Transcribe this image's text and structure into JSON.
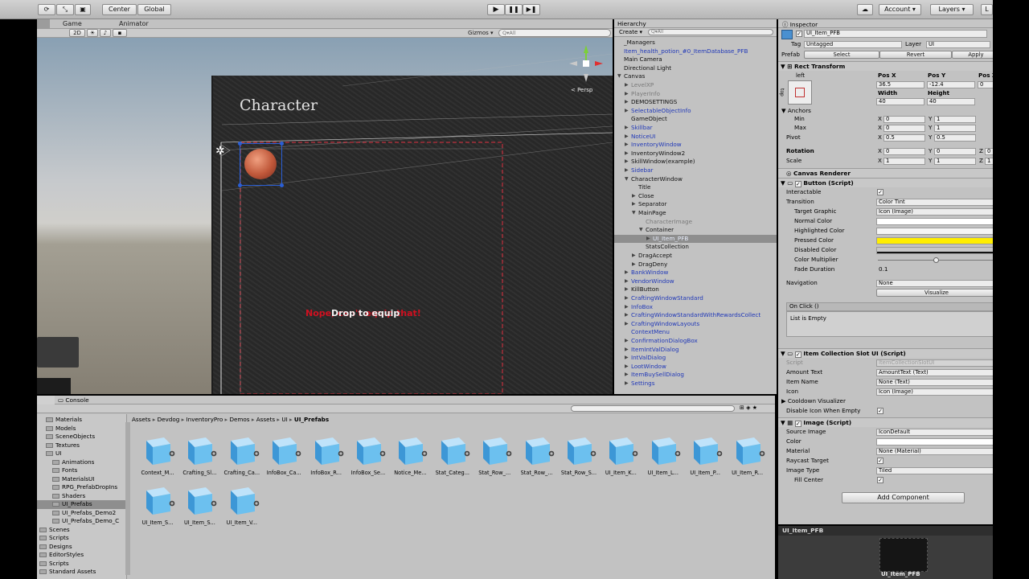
{
  "toolbar": {
    "center": "Center",
    "global": "Global",
    "account": "Account ▾",
    "layers": "Layers ▾",
    "layout": "L"
  },
  "scene": {
    "tabs": {
      "game": "Game",
      "animator": "Animator"
    },
    "mode_2d": "2D",
    "gizmos": "Gizmos ▾",
    "search": "Q▾All",
    "persp": "< Persp",
    "panel_title": "Character",
    "overlay_red": "Nope, can't equip that!",
    "overlay_white": "Drop to equip"
  },
  "hierarchy": {
    "title": "Hierarchy",
    "create": "Create ▾",
    "search": "Q▾All",
    "items": [
      {
        "label": "_Managers",
        "cls": "dark",
        "indent": 0,
        "arrow": ""
      },
      {
        "label": "Item_health_potion_#0_ItemDatabase_PFB",
        "cls": "blue",
        "indent": 0,
        "arrow": ""
      },
      {
        "label": "Main Camera",
        "cls": "dark",
        "indent": 0,
        "arrow": ""
      },
      {
        "label": "Directional Light",
        "cls": "dark",
        "indent": 0,
        "arrow": ""
      },
      {
        "label": "Canvas",
        "cls": "dark",
        "indent": 0,
        "arrow": "▼"
      },
      {
        "label": "LevelXP",
        "cls": "gray",
        "indent": 1,
        "arrow": "▶"
      },
      {
        "label": "PlayerInfo",
        "cls": "gray",
        "indent": 1,
        "arrow": "▶"
      },
      {
        "label": "DEMOSETTINGS",
        "cls": "dark",
        "indent": 1,
        "arrow": "▶"
      },
      {
        "label": "SelectableObjectInfo",
        "cls": "blue",
        "indent": 1,
        "arrow": "▶"
      },
      {
        "label": "GameObject",
        "cls": "dark",
        "indent": 1,
        "arrow": ""
      },
      {
        "label": "Skillbar",
        "cls": "blue",
        "indent": 1,
        "arrow": "▶"
      },
      {
        "label": "NoticeUI",
        "cls": "blue",
        "indent": 1,
        "arrow": "▶"
      },
      {
        "label": "InventoryWindow",
        "cls": "blue",
        "indent": 1,
        "arrow": "▶"
      },
      {
        "label": "InventoryWindow2",
        "cls": "dark",
        "indent": 1,
        "arrow": "▶"
      },
      {
        "label": "SkillWindow(example)",
        "cls": "dark",
        "indent": 1,
        "arrow": "▶"
      },
      {
        "label": "Sidebar",
        "cls": "blue",
        "indent": 1,
        "arrow": "▶"
      },
      {
        "label": "CharacterWindow",
        "cls": "dark",
        "indent": 1,
        "arrow": "▼"
      },
      {
        "label": "Title",
        "cls": "dark",
        "indent": 2,
        "arrow": ""
      },
      {
        "label": "Close",
        "cls": "dark",
        "indent": 2,
        "arrow": "▶"
      },
      {
        "label": "Separator",
        "cls": "dark",
        "indent": 2,
        "arrow": "▶"
      },
      {
        "label": "MainPage",
        "cls": "dark",
        "indent": 2,
        "arrow": "▼"
      },
      {
        "label": "CharacterImage",
        "cls": "gray",
        "indent": 3,
        "arrow": ""
      },
      {
        "label": "Container",
        "cls": "dark",
        "indent": 3,
        "arrow": "▼"
      },
      {
        "label": "UI_Item_PFB",
        "cls": "sel",
        "indent": 4,
        "arrow": "▶"
      },
      {
        "label": "StatsCollection",
        "cls": "dark",
        "indent": 3,
        "arrow": ""
      },
      {
        "label": "DragAccept",
        "cls": "dark",
        "indent": 2,
        "arrow": "▶"
      },
      {
        "label": "DragDeny",
        "cls": "dark",
        "indent": 2,
        "arrow": "▶"
      },
      {
        "label": "BankWindow",
        "cls": "blue",
        "indent": 1,
        "arrow": "▶"
      },
      {
        "label": "VendorWindow",
        "cls": "blue",
        "indent": 1,
        "arrow": "▶"
      },
      {
        "label": "KillButton",
        "cls": "dark",
        "indent": 1,
        "arrow": "▶"
      },
      {
        "label": "CraftingWindowStandard",
        "cls": "blue",
        "indent": 1,
        "arrow": "▶"
      },
      {
        "label": "InfoBox",
        "cls": "blue",
        "indent": 1,
        "arrow": "▶"
      },
      {
        "label": "CraftingWindowStandardWithRewardsCollect",
        "cls": "blue",
        "indent": 1,
        "arrow": "▶"
      },
      {
        "label": "CraftingWindowLayouts",
        "cls": "blue",
        "indent": 1,
        "arrow": "▶"
      },
      {
        "label": "ContextMenu",
        "cls": "blue",
        "indent": 1,
        "arrow": ""
      },
      {
        "label": "ConfirmationDialogBox",
        "cls": "blue",
        "indent": 1,
        "arrow": "▶"
      },
      {
        "label": "ItemIntValDialog",
        "cls": "blue",
        "indent": 1,
        "arrow": "▶"
      },
      {
        "label": "IntValDialog",
        "cls": "blue",
        "indent": 1,
        "arrow": "▶"
      },
      {
        "label": "LootWindow",
        "cls": "blue",
        "indent": 1,
        "arrow": "▶"
      },
      {
        "label": "ItemBuySellDialog",
        "cls": "blue",
        "indent": 1,
        "arrow": "▶"
      },
      {
        "label": "Settings",
        "cls": "blue",
        "indent": 1,
        "arrow": "▶"
      }
    ]
  },
  "inspector": {
    "title": "Inspector",
    "object_name": "UI_Item_PFB",
    "tag_label": "Tag",
    "tag_value": "Untagged",
    "layer_label": "Layer",
    "layer_value": "UI",
    "prefab_label": "Prefab",
    "select": "Select",
    "revert": "Revert",
    "apply": "Apply",
    "rect": {
      "title": "Rect Transform",
      "left": "left",
      "top": "top",
      "pos_x_label": "Pos X",
      "pos_y_label": "Pos Y",
      "pos_z_label": "Pos Z",
      "pos_x": "36.5",
      "pos_y": "-12.4",
      "pos_z": "0",
      "width_label": "Width",
      "height_label": "Height",
      "width": "40",
      "height": "40",
      "anchors": "Anchors",
      "min": "Min",
      "max": "Max",
      "pivot": "Pivot",
      "min_x": "0",
      "min_y": "1",
      "max_x": "0",
      "max_y": "1",
      "pivot_x": "0.5",
      "pivot_y": "0.5",
      "rotation": "Rotation",
      "scale": "Scale",
      "rot_x": "0",
      "rot_y": "0",
      "rot_z": "0",
      "scale_x": "1",
      "scale_y": "1",
      "scale_z": "1"
    },
    "canvas_renderer": "Canvas Renderer",
    "button": {
      "title": "Button (Script)",
      "interactable": "Interactable",
      "transition": "Transition",
      "transition_value": "Color Tint",
      "target_graphic": "Target Graphic",
      "target_value": "Icon (Image)",
      "normal": "Normal Color",
      "highlighted": "Highlighted Color",
      "pressed": "Pressed Color",
      "disabled": "Disabled Color",
      "multiplier": "Color Multiplier",
      "fade": "Fade Duration",
      "fade_value": "0.1",
      "navigation": "Navigation",
      "navigation_value": "None",
      "visualize": "Visualize",
      "onclick": "On Click ()",
      "list_empty": "List is Empty",
      "pressed_color": "#ffee00"
    },
    "ics": {
      "title": "Item Collection Slot UI (Script)",
      "script": "Script",
      "script_value": "ItemCollectionSlotUI",
      "amount": "Amount Text",
      "amount_value": "AmountText (Text)",
      "item_name": "Item Name",
      "item_name_value": "None (Text)",
      "icon": "Icon",
      "icon_value": "Icon (Image)",
      "cooldown": "Cooldown Visualizer",
      "disable": "Disable Icon When Empty"
    },
    "image": {
      "title": "Image (Script)",
      "source": "Source Image",
      "source_value": "IconDefault",
      "color": "Color",
      "material": "Material",
      "material_value": "None (Material)",
      "raycast": "Raycast Target",
      "type": "Image Type",
      "type_value": "Tiled",
      "fill": "Fill Center"
    },
    "add_component": "Add Component"
  },
  "preview": {
    "title": "UI_Item_PFB",
    "caption": "UI_Item_PFB"
  },
  "project": {
    "console_tab": "Console",
    "breadcrumb": [
      "Assets",
      "Devdog",
      "InventoryPro",
      "Demos",
      "Assets",
      "UI",
      "UI_Prefabs"
    ],
    "tree": [
      {
        "label": "Materials",
        "indent": 1
      },
      {
        "label": "Models",
        "indent": 1
      },
      {
        "label": "SceneObjects",
        "indent": 1
      },
      {
        "label": "Textures",
        "indent": 1
      },
      {
        "label": "UI",
        "indent": 1
      },
      {
        "label": "Animations",
        "indent": 2
      },
      {
        "label": "Fonts",
        "indent": 2
      },
      {
        "label": "MaterialsUI",
        "indent": 2
      },
      {
        "label": "RPG_PrefabDropIns",
        "indent": 2
      },
      {
        "label": "Shaders",
        "indent": 2
      },
      {
        "label": "UI_Prefabs",
        "indent": 2,
        "sel": true
      },
      {
        "label": "UI_Prefabs_Demo2",
        "indent": 2
      },
      {
        "label": "UI_Prefabs_Demo_C",
        "indent": 2
      },
      {
        "label": "Scenes",
        "indent": 0
      },
      {
        "label": "Scripts",
        "indent": 0
      },
      {
        "label": "Designs",
        "indent": 0
      },
      {
        "label": "EditorStyles",
        "indent": 0
      },
      {
        "label": "Scripts",
        "indent": 0
      },
      {
        "label": "Standard Assets",
        "indent": 0
      }
    ],
    "assets": [
      "Context_M...",
      "Crafting_Sl...",
      "Crafting_Ca...",
      "InfoBox_Ca...",
      "InfoBox_R...",
      "InfoBox_Se...",
      "Notice_Me...",
      "Stat_Categ...",
      "Stat_Row_...",
      "Stat_Row_...",
      "Stat_Row_S...",
      "UI_Item_K...",
      "UI_Item_L...",
      "UI_Item_P...",
      "UI_Item_R...",
      "UI_Item_S...",
      "UI_Item_S...",
      "UI_Item_V..."
    ]
  }
}
